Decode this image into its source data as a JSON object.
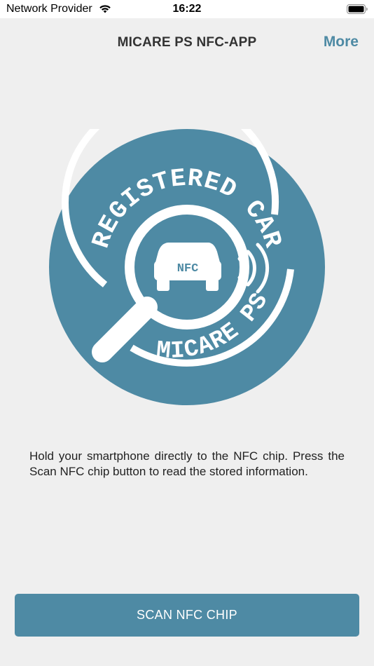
{
  "status_bar": {
    "carrier": "Network Provider",
    "time": "16:22",
    "wifi_icon": "wifi-icon",
    "battery_icon": "battery-full-icon"
  },
  "nav": {
    "title": "MICARE PS NFC-APP",
    "more_label": "More"
  },
  "logo": {
    "top_text": "REGISTERED CAR",
    "bottom_text": "MICARE PS",
    "badge_text": "NFC",
    "icons": [
      "magnifier-icon",
      "car-icon",
      "nfc-waves-icon"
    ]
  },
  "instructions": "Hold your smartphone directly to the NFC chip. Press the Scan NFC chip button to read the stored information.",
  "scan_button_label": "SCAN NFC CHIP",
  "colors": {
    "accent": "#4e8aa4",
    "background": "#efefef",
    "title": "#333333"
  }
}
